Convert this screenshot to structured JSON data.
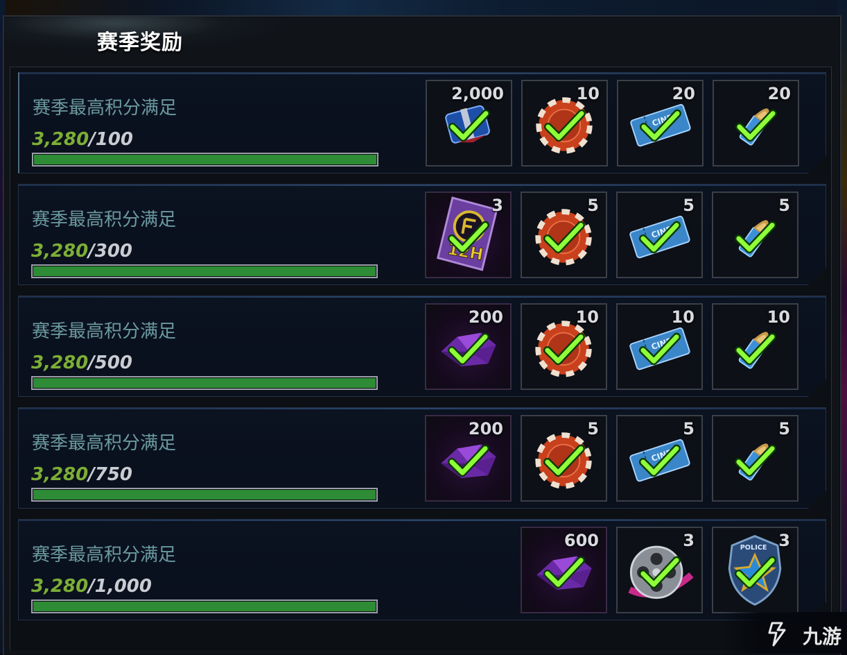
{
  "title": "赛季奖励",
  "colors": {
    "progress_fill": "#2d8c35",
    "current_value": "#7cae36",
    "condition_text": "#6b9aa0",
    "check": "#8fff3a"
  },
  "rows": [
    {
      "condition": "赛季最高积分满足",
      "current": "3,280",
      "max": "/100",
      "progress_fraction": 1.0,
      "rewards": [
        {
          "icon": "gift-box-icon",
          "qty": "2,000",
          "claimed": true
        },
        {
          "icon": "casino-chip-icon",
          "qty": "10",
          "claimed": true
        },
        {
          "icon": "cinema-ticket-icon",
          "qty": "20",
          "claimed": true
        },
        {
          "icon": "bullet-icon",
          "qty": "20",
          "claimed": true
        }
      ]
    },
    {
      "condition": "赛季最高积分满足",
      "current": "3,280",
      "max": "/300",
      "progress_fraction": 1.0,
      "rewards": [
        {
          "icon": "speedup-card-12h-icon",
          "qty": "3",
          "claimed": true,
          "card_label": "12H"
        },
        {
          "icon": "casino-chip-icon",
          "qty": "5",
          "claimed": true
        },
        {
          "icon": "cinema-ticket-icon",
          "qty": "5",
          "claimed": true
        },
        {
          "icon": "bullet-icon",
          "qty": "5",
          "claimed": true
        }
      ]
    },
    {
      "condition": "赛季最高积分满足",
      "current": "3,280",
      "max": "/500",
      "progress_fraction": 1.0,
      "rewards": [
        {
          "icon": "purple-crystal-icon",
          "qty": "200",
          "claimed": true
        },
        {
          "icon": "casino-chip-icon",
          "qty": "10",
          "claimed": true
        },
        {
          "icon": "cinema-ticket-icon",
          "qty": "10",
          "claimed": true
        },
        {
          "icon": "bullet-icon",
          "qty": "10",
          "claimed": true
        }
      ]
    },
    {
      "condition": "赛季最高积分满足",
      "current": "3,280",
      "max": "/750",
      "progress_fraction": 1.0,
      "rewards": [
        {
          "icon": "purple-crystal-icon",
          "qty": "200",
          "claimed": true
        },
        {
          "icon": "casino-chip-icon",
          "qty": "5",
          "claimed": true
        },
        {
          "icon": "cinema-ticket-icon",
          "qty": "5",
          "claimed": true
        },
        {
          "icon": "bullet-icon",
          "qty": "5",
          "claimed": true
        }
      ]
    },
    {
      "condition": "赛季最高积分满足",
      "current": "3,280",
      "max": "/1,000",
      "progress_fraction": 1.0,
      "rewards": [
        {
          "icon": "purple-crystal-icon",
          "qty": "600",
          "claimed": true
        },
        {
          "icon": "film-reel-icon",
          "qty": "3",
          "claimed": true
        },
        {
          "icon": "police-badge-icon",
          "qty": "3",
          "claimed": true
        }
      ]
    }
  ],
  "watermark": "九游"
}
